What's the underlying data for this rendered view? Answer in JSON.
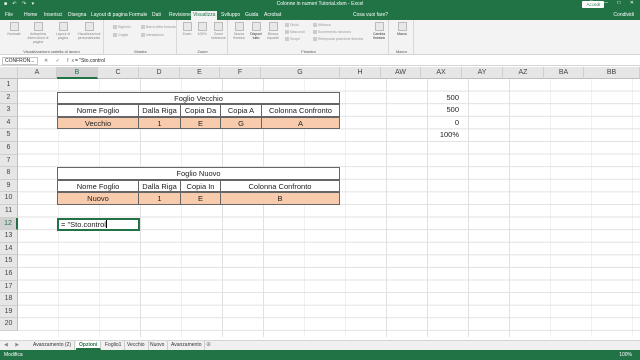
{
  "window": {
    "title": "Colonne in numeri Tutorial.xlsm - Excel",
    "signin": "Accedi",
    "quick_access": "■ ↶ ↷ ▾"
  },
  "tabs": [
    "File",
    "Home",
    "Inserisci",
    "Disegna",
    "Layout di pagina",
    "Formule",
    "Dati",
    "Revisione",
    "Visualizza",
    "Sviluppo",
    "Guida",
    "Acrobat"
  ],
  "active_tab": "Visualizza",
  "tell_me": "Cosa vuoi fare?",
  "share": "Condividi",
  "ribbon": {
    "groups": [
      {
        "label": "Visualizzazioni cartella di lavoro",
        "buttons": [
          "Normale",
          "Anteprima interruzioni di pagina",
          "Layout di pagina",
          "Visualizzazioni personalizzate"
        ]
      },
      {
        "label": "Mostra",
        "buttons": [
          "Righello",
          "Griglia",
          "Barra della formula",
          "Intestazioni"
        ]
      },
      {
        "label": "Zoom",
        "buttons": [
          "Zoom",
          "100%",
          "Zoom selezione"
        ]
      },
      {
        "label": "Finestra",
        "buttons": [
          "Nuova finestra",
          "Disponi tutto",
          "Blocca riquadri",
          "Dividi",
          "Nascondi",
          "Scopri",
          "Affianca",
          "Scorrimento sincrono",
          "Reimposta posizione finestra",
          "Cambia finestra"
        ]
      },
      {
        "label": "Macro",
        "buttons": [
          "Macro"
        ]
      }
    ]
  },
  "formula_bar": {
    "name_box": "CONFRON...",
    "icons": "✕ ✓ fx",
    "content": "= \"Sto.control"
  },
  "columns": [
    "A",
    "B",
    "C",
    "D",
    "E",
    "F",
    "G",
    "H",
    "AW",
    "AX",
    "AY",
    "AZ",
    "BA",
    "BB"
  ],
  "rows": [
    "1",
    "2",
    "3",
    "4",
    "5",
    "6",
    "7",
    "8",
    "9",
    "10",
    "11",
    "12",
    "13",
    "14",
    "15",
    "16",
    "17",
    "18",
    "19",
    "20"
  ],
  "selected_column": "B",
  "selected_row": "12",
  "table_old": {
    "title": "Foglio Vecchio",
    "headers": [
      "Nome Foglio",
      "Dalla Riga",
      "Copia Da",
      "Copia A",
      "Colonna Confronto"
    ],
    "values": [
      "Vecchio",
      "1",
      "E",
      "G",
      "A"
    ]
  },
  "table_new": {
    "title": "Foglio Nuovo",
    "headers": [
      "Nome Foglio",
      "Dalla Riga",
      "Copia In",
      "Colonna Confronto"
    ],
    "values": [
      "Nuovo",
      "1",
      "E",
      "B"
    ]
  },
  "ax_values": [
    "500",
    "500",
    "0",
    "100%"
  ],
  "edit_cell": "= \"Sto.control",
  "sheet_tabs": [
    "Avanzamento (2)",
    "Opzioni",
    "Foglio1",
    "Vecchio",
    "Nuovo",
    "Avanzamento"
  ],
  "active_sheet": "Opzioni",
  "status": {
    "mode": "Modifica",
    "zoom": "100%"
  },
  "colors": {
    "excel_green": "#217346",
    "header_fill": "#f8cbad"
  }
}
